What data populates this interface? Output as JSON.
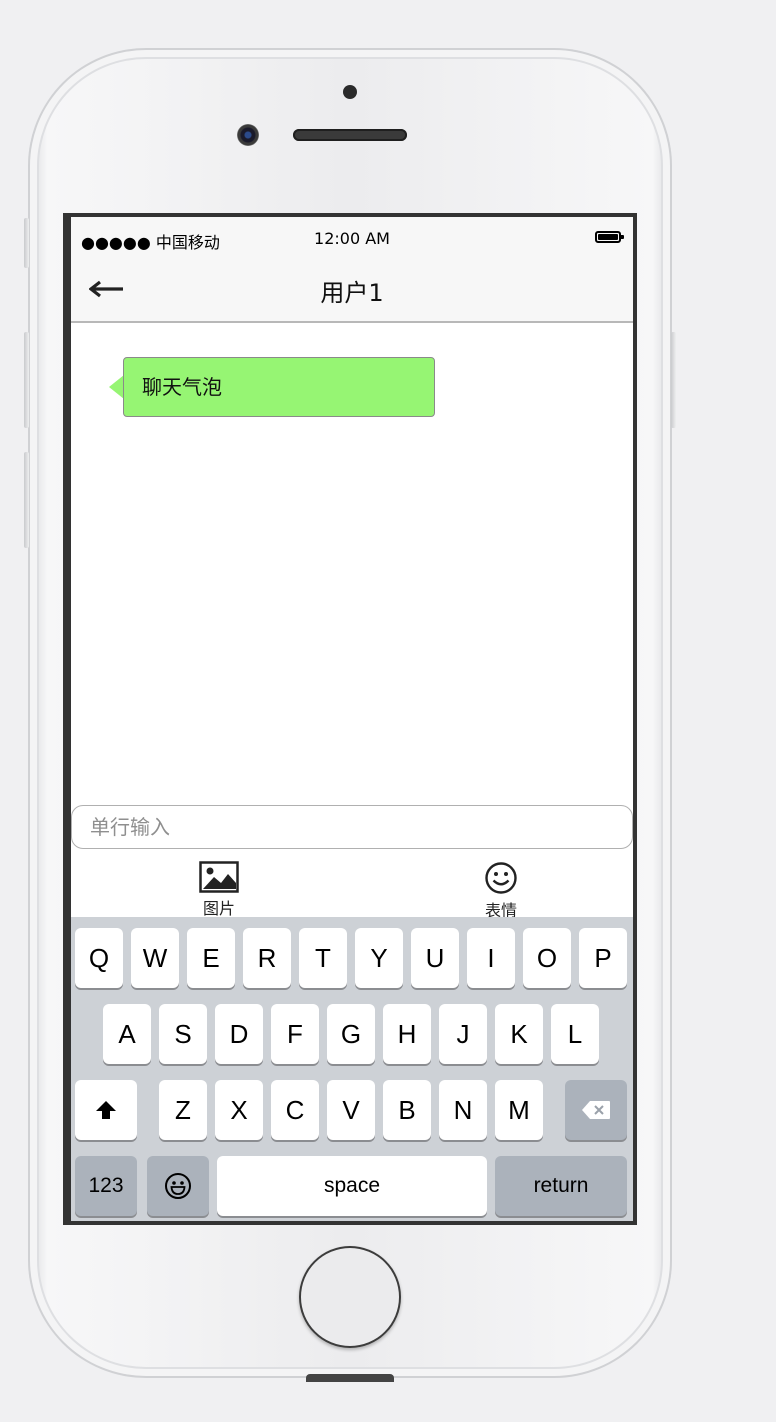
{
  "status_bar": {
    "carrier": "●●●●● 中国移动",
    "time": "12:00 AM"
  },
  "nav": {
    "back_icon": "arrow-left-icon",
    "title": "用户1"
  },
  "chat": {
    "messages": [
      {
        "text": "聊天气泡",
        "color": "#96f573"
      }
    ]
  },
  "composer": {
    "placeholder": "单行输入",
    "value": ""
  },
  "tools": {
    "image_label": "图片",
    "image_icon": "image-icon",
    "emoji_label": "表情",
    "emoji_icon": "smiley-icon"
  },
  "keyboard": {
    "row1": [
      "Q",
      "W",
      "E",
      "R",
      "T",
      "Y",
      "U",
      "I",
      "O",
      "P"
    ],
    "row2": [
      "A",
      "S",
      "D",
      "F",
      "G",
      "H",
      "J",
      "K",
      "L"
    ],
    "row3": [
      "Z",
      "X",
      "C",
      "V",
      "B",
      "N",
      "M"
    ],
    "shift_icon": "shift-icon",
    "backspace_icon": "backspace-icon",
    "numbers_label": "123",
    "emoji_icon": "emoji-key-icon",
    "space_label": "space",
    "return_label": "return"
  }
}
